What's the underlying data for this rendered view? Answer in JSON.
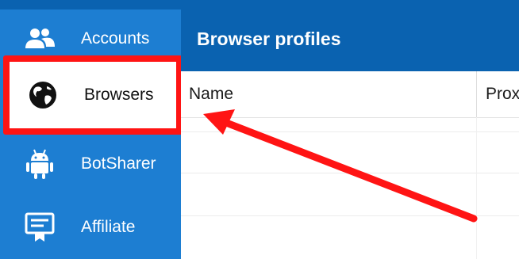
{
  "sidebar": {
    "items": [
      {
        "label": "Accounts",
        "icon": "users-icon",
        "active": false
      },
      {
        "label": "Browsers",
        "icon": "globe-icon",
        "active": true
      },
      {
        "label": "BotSharer",
        "icon": "android-icon",
        "active": false
      },
      {
        "label": "Affiliate",
        "icon": "certificate-icon",
        "active": false
      }
    ]
  },
  "main": {
    "title": "Browser profiles",
    "table": {
      "columns": [
        "Name",
        "Prox"
      ]
    }
  },
  "annotation": {
    "highlight_color": "#ff1414"
  },
  "colors": {
    "sidebar_bg": "#1d7ed2",
    "header_bg": "#0a62b0"
  }
}
